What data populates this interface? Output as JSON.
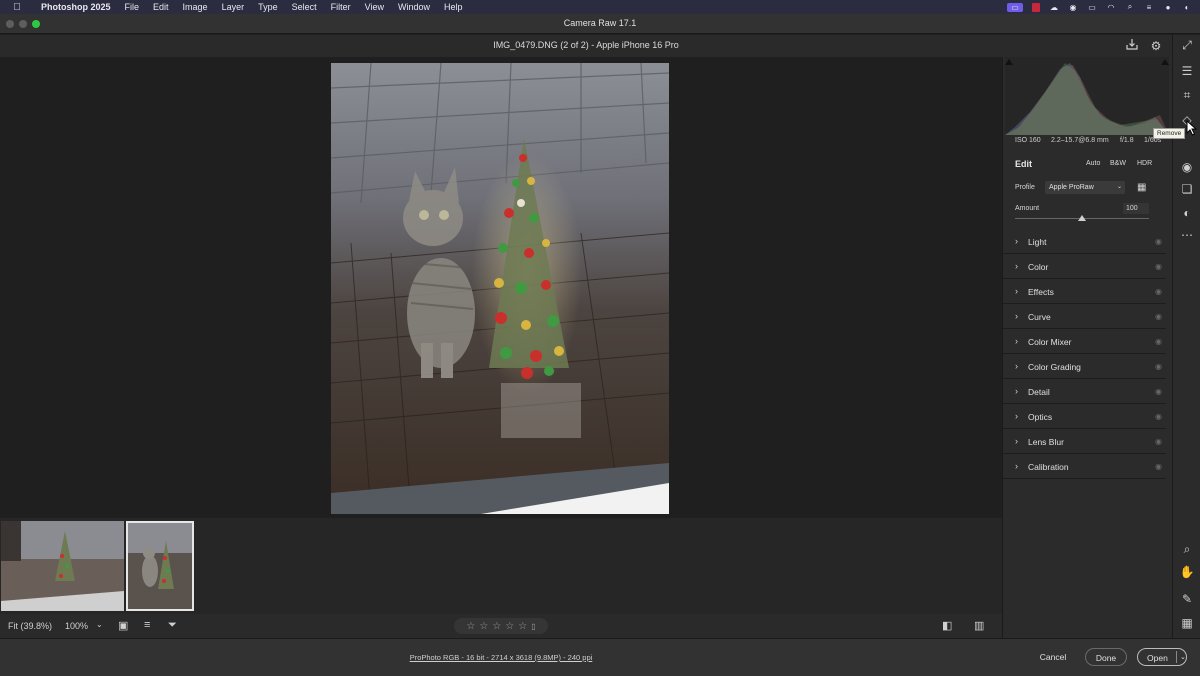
{
  "menubar": {
    "app": "Photoshop 2025",
    "items": [
      "File",
      "Edit",
      "Image",
      "Layer",
      "Type",
      "Select",
      "Filter",
      "View",
      "Window",
      "Help"
    ]
  },
  "window": {
    "title": "Camera Raw 17.1"
  },
  "header": {
    "filename": "IMG_0479.DNG (2 of 2)  -  Apple iPhone 16 Pro"
  },
  "exif": {
    "iso": "ISO 160",
    "lens": "2.2–15.7@6.8 mm",
    "aperture": "f/1.8",
    "shutter": "1/60s"
  },
  "edit": {
    "title": "Edit",
    "auto_label": "Auto",
    "bw_label": "B&W",
    "hdr_label": "HDR",
    "profile_label": "Profile",
    "profile_value": "Apple ProRaw",
    "amount_label": "Amount",
    "amount_value": "100",
    "amount_level": 0.5
  },
  "sections": [
    {
      "label": "Light"
    },
    {
      "label": "Color"
    },
    {
      "label": "Effects"
    },
    {
      "label": "Curve"
    },
    {
      "label": "Color Mixer"
    },
    {
      "label": "Color Grading"
    },
    {
      "label": "Detail"
    },
    {
      "label": "Optics"
    },
    {
      "label": "Lens Blur"
    },
    {
      "label": "Calibration"
    }
  ],
  "tooltip": {
    "text": "Remove"
  },
  "bottombar": {
    "fit": "Fit (39.8%)",
    "zoom": "100%",
    "stars": 5
  },
  "footer": {
    "workflow": "ProPhoto RGB - 16 bit - 2714 x 3618 (9.8MP) - 240 ppi",
    "cancel": "Cancel",
    "done": "Done",
    "open": "Open"
  },
  "colors": {
    "accent": "#2ec944",
    "tray_accent": "#6f5ce8"
  }
}
